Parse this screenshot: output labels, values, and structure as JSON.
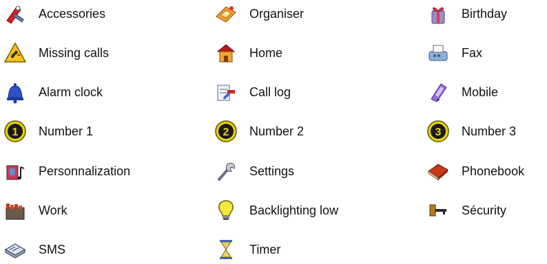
{
  "items": [
    {
      "label": "Accessories",
      "icon": "accessories-icon"
    },
    {
      "label": "Organiser",
      "icon": "organiser-icon"
    },
    {
      "label": "Birthday",
      "icon": "birthday-icon"
    },
    {
      "label": "Missing calls",
      "icon": "missing-calls-icon"
    },
    {
      "label": "Home",
      "icon": "home-icon"
    },
    {
      "label": "Fax",
      "icon": "fax-icon"
    },
    {
      "label": "Alarm clock",
      "icon": "alarm-clock-icon"
    },
    {
      "label": "Call log",
      "icon": "call-log-icon"
    },
    {
      "label": "Mobile",
      "icon": "mobile-icon"
    },
    {
      "label": "Number 1",
      "icon": "number-1-icon"
    },
    {
      "label": "Number 2",
      "icon": "number-2-icon"
    },
    {
      "label": "Number 3",
      "icon": "number-3-icon"
    },
    {
      "label": "Personnalization",
      "icon": "personnalization-icon"
    },
    {
      "label": "Settings",
      "icon": "settings-icon"
    },
    {
      "label": "Phonebook",
      "icon": "phonebook-icon"
    },
    {
      "label": "Work",
      "icon": "work-icon"
    },
    {
      "label": "Backlighting low",
      "icon": "backlighting-low-icon"
    },
    {
      "label": "Sécurity",
      "icon": "security-icon"
    },
    {
      "label": "SMS",
      "icon": "sms-icon"
    },
    {
      "label": "Timer",
      "icon": "timer-icon"
    }
  ],
  "colors": {
    "text": "#111111",
    "background": "#ffffff"
  }
}
